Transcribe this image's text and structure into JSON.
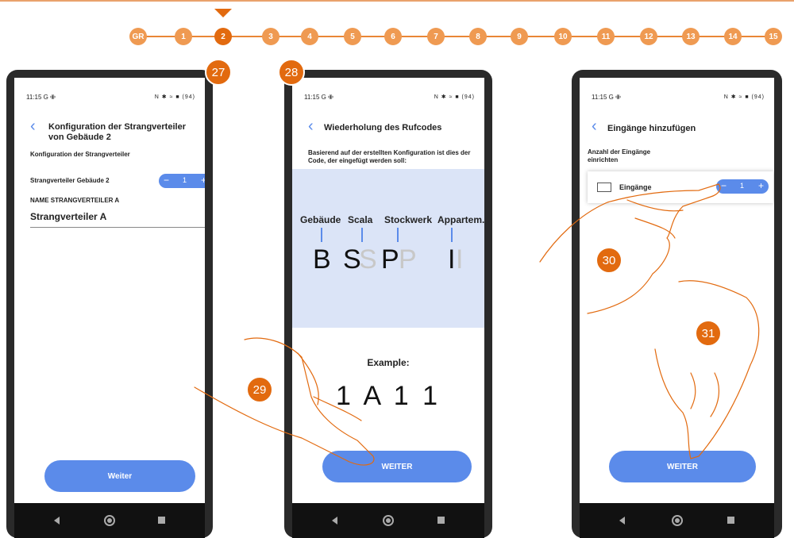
{
  "steps": [
    "GR",
    "1",
    "2",
    "3",
    "4",
    "5",
    "6",
    "7",
    "8",
    "9",
    "10",
    "11",
    "12",
    "13",
    "14",
    "15"
  ],
  "active_step": "2",
  "badges": {
    "b27": "27",
    "b28": "28",
    "b29": "29",
    "b30": "30",
    "b31": "31"
  },
  "status": {
    "time": "11:15",
    "icons_left": "G ✙",
    "icons_right": "N ✱ ≈ ■ (94)"
  },
  "screen1": {
    "title": "Konfiguration der Strangverteiler von Gebäude 2",
    "subtitle": "Konfiguration der Strangverteiler",
    "row_label": "Strangverteiler Gebäude 2",
    "stepper_value": "1",
    "field_label": "NAME STRANGVERTEILER A",
    "field_value": "Strangverteiler A",
    "button": "Weiter"
  },
  "screen2": {
    "title": "Wiederholung des Rufcodes",
    "description": "Basierend auf der erstellten Konfiguration ist dies der Code, der eingefügt werden soll:",
    "labels": [
      "Gebäude",
      "Scala",
      "Stockwerk",
      "Appartem.."
    ],
    "letters": [
      "B",
      "S",
      "S",
      "P",
      "P",
      "I",
      "I"
    ],
    "example_label": "Example:",
    "example_code": "1 A 1 1",
    "button": "WEITER"
  },
  "screen3": {
    "title": "Eingänge hinzufügen",
    "subtitle": "Anzahl der Eingänge einrichten",
    "row_label": "Eingänge",
    "stepper_value": "1",
    "button": "WEITER"
  },
  "icons": {
    "minus": "minus-icon",
    "plus": "plus-icon",
    "back": "chevron-left-icon"
  },
  "colors": {
    "accent": "#e26a0f",
    "step": "#ef9a52",
    "blue": "#5b8bea",
    "code_bg": "#dbe4f7"
  }
}
